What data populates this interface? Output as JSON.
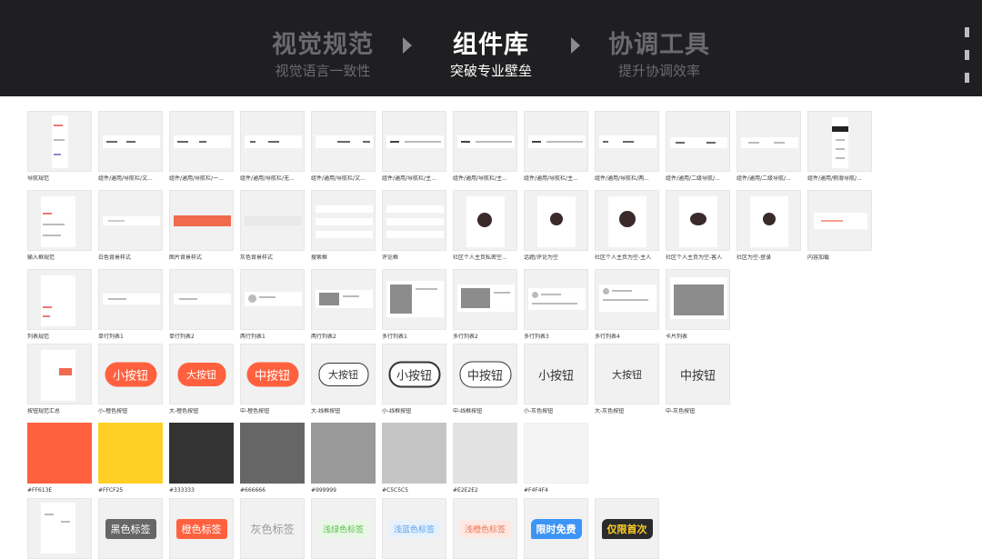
{
  "header": {
    "steps": [
      {
        "title": "视觉规范",
        "subtitle": "视觉语言一致性"
      },
      {
        "title": "组件库",
        "subtitle": "突破专业壁垒"
      },
      {
        "title": "协调工具",
        "subtitle": "提升协调效率"
      }
    ]
  },
  "rows": {
    "r1": [
      "导航规范",
      "组件/通用/导航栏/文...",
      "组件/通用/导航栏/一...",
      "组件/通用/导航栏/无...",
      "组件/通用/导航栏/文...",
      "组件/通用/导航栏/主...",
      "组件/通用/导航栏/主...",
      "组件/通用/导航栏/主...",
      "组件/通用/导航栏/两...",
      "组件/通用/二级导航/...",
      "组件/通用/二级导航/...",
      "组件/通用/侧滑导航/..."
    ],
    "r2": [
      "输入框规范",
      "白色背景样式",
      "图片背景样式",
      "灰色背景样式",
      "搜索框",
      "评论框",
      "社区个人主页私密空...",
      "话题/评论为空",
      "社区个人主页为空-主人",
      "社区个人主页为空-客人",
      "社区为空-登录",
      "内容加载"
    ],
    "r3": [
      "列表规范",
      "单行列表1",
      "单行列表2",
      "两行列表1",
      "两行列表2",
      "多行列表1",
      "多行列表2",
      "多行列表3",
      "多行列表4",
      "卡片列表"
    ],
    "r4": [
      "按钮规范汇总",
      "小-橙色按钮",
      "大-橙色按钮",
      "中-橙色按钮",
      "大-线框按钮",
      "小-线框按钮",
      "中-线框按钮",
      "小-灰色按钮",
      "大-灰色按钮",
      "中-灰色按钮"
    ],
    "r5": [
      "#FF613E",
      "#FFCF25",
      "#333333",
      "#666666",
      "#999999",
      "#C5C5C5",
      "#E2E2E2",
      "#F4F4F4"
    ]
  },
  "buttons": {
    "small_orange": "小按钮",
    "large_orange": "大按钮",
    "mid_orange": "中按钮",
    "large_line": "大按钮",
    "small_line": "小按钮",
    "mid_line": "中按钮",
    "small_gray": "小按钮",
    "large_gray": "大按钮",
    "mid_gray": "中按钮"
  },
  "swatches": [
    "#FF613E",
    "#FFCF25",
    "#333333",
    "#666666",
    "#999999",
    "#C5C5C5",
    "#E2E2E2",
    "#F4F4F4"
  ],
  "tags": {
    "black": "黑色标签",
    "orange": "橙色标签",
    "gray": "灰色标签",
    "light_green": "浅绿色标签",
    "light_blue": "浅蓝色标签",
    "light_orange": "浅橙色标签",
    "free": "限时免费",
    "first": "仅限首次"
  }
}
